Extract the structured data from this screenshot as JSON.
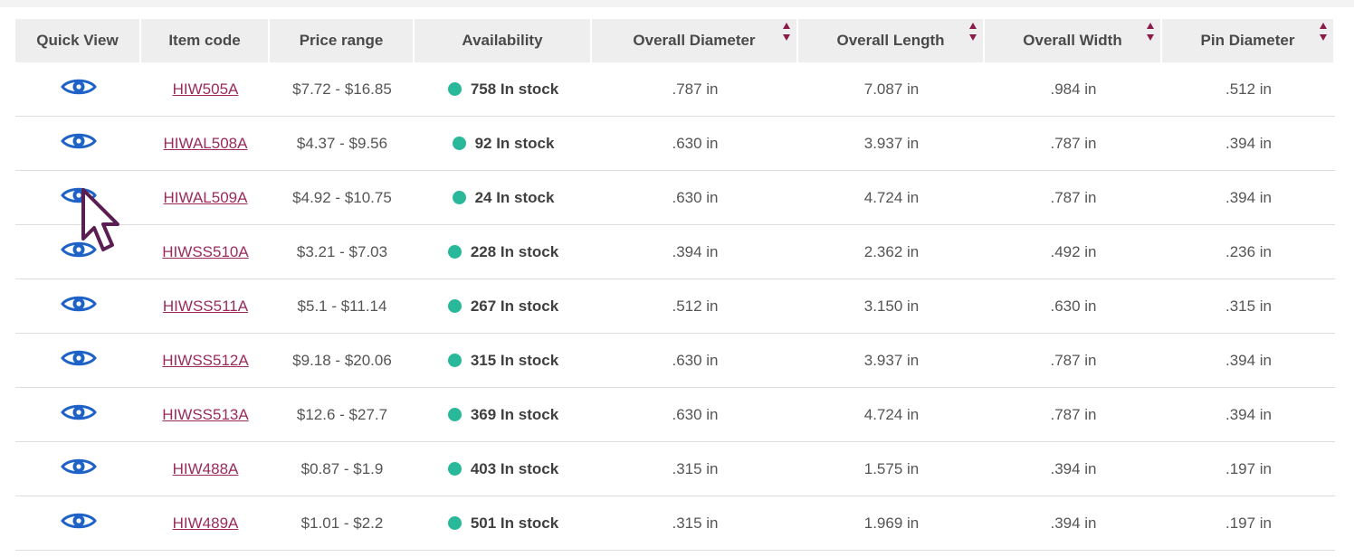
{
  "columns": [
    {
      "label": "Quick View",
      "sortable": false
    },
    {
      "label": "Item code",
      "sortable": false
    },
    {
      "label": "Price range",
      "sortable": false
    },
    {
      "label": "Availability",
      "sortable": false
    },
    {
      "label": "Overall Diameter",
      "sortable": true
    },
    {
      "label": "Overall Length",
      "sortable": true
    },
    {
      "label": "Overall Width",
      "sortable": true
    },
    {
      "label": "Pin Diameter",
      "sortable": true
    }
  ],
  "rows": [
    {
      "code": "HIW505A",
      "price": "$7.72 - $16.85",
      "stock": "758 In stock",
      "diameter": ".787 in",
      "length": "7.087 in",
      "width": ".984 in",
      "pin": ".512 in"
    },
    {
      "code": "HIWAL508A",
      "price": "$4.37 - $9.56",
      "stock": "92 In stock",
      "diameter": ".630 in",
      "length": "3.937 in",
      "width": ".787 in",
      "pin": ".394 in"
    },
    {
      "code": "HIWAL509A",
      "price": "$4.92 - $10.75",
      "stock": "24 In stock",
      "diameter": ".630 in",
      "length": "4.724 in",
      "width": ".787 in",
      "pin": ".394 in"
    },
    {
      "code": "HIWSS510A",
      "price": "$3.21 - $7.03",
      "stock": "228 In stock",
      "diameter": ".394 in",
      "length": "2.362 in",
      "width": ".492 in",
      "pin": ".236 in"
    },
    {
      "code": "HIWSS511A",
      "price": "$5.1 - $11.14",
      "stock": "267 In stock",
      "diameter": ".512 in",
      "length": "3.150 in",
      "width": ".630 in",
      "pin": ".315 in"
    },
    {
      "code": "HIWSS512A",
      "price": "$9.18 - $20.06",
      "stock": "315 In stock",
      "diameter": ".630 in",
      "length": "3.937 in",
      "width": ".787 in",
      "pin": ".394 in"
    },
    {
      "code": "HIWSS513A",
      "price": "$12.6 - $27.7",
      "stock": "369 In stock",
      "diameter": ".630 in",
      "length": "4.724 in",
      "width": ".787 in",
      "pin": ".394 in"
    },
    {
      "code": "HIW488A",
      "price": "$0.87 - $1.9",
      "stock": "403 In stock",
      "diameter": ".315 in",
      "length": "1.575 in",
      "width": ".394 in",
      "pin": ".197 in"
    },
    {
      "code": "HIW489A",
      "price": "$1.01 - $2.2",
      "stock": "501 In stock",
      "diameter": ".315 in",
      "length": "1.969 in",
      "width": ".394 in",
      "pin": ".197 in"
    }
  ],
  "colors": {
    "link": "#9a2b5c",
    "in_stock_dot": "#29b99a",
    "eye_icon": "#1e62c8",
    "sort_arrow": "#8a1c4a",
    "header_bg": "#eeeeee"
  },
  "icons": {
    "quick_view": "eye-icon",
    "sort": "sort-arrows-icon",
    "cursor": "mouse-pointer-icon"
  }
}
